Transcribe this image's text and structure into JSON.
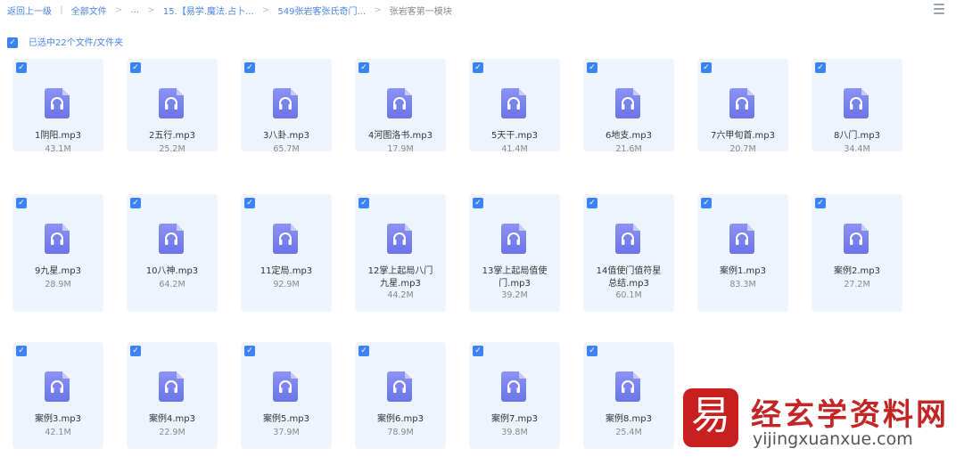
{
  "breadcrumb": {
    "back": "返回上一级",
    "root": "全部文件",
    "ellipsis": "...",
    "level1": "15.【易学.魔法.占卜...",
    "level2": "549张岩客张氏奇门...",
    "current": "张岩客第一模块"
  },
  "selection": {
    "text": "已选中22个文件/文件夹"
  },
  "icons": {
    "check": "checkmark-icon",
    "file": "audio-file-icon",
    "view": "list-view-icon"
  },
  "files": [
    {
      "name": "1阴阳.mp3",
      "size": "43.1M"
    },
    {
      "name": "2五行.mp3",
      "size": "25.2M"
    },
    {
      "name": "3八卦.mp3",
      "size": "65.7M"
    },
    {
      "name": "4河图洛书.mp3",
      "size": "17.9M"
    },
    {
      "name": "5天干.mp3",
      "size": "41.4M"
    },
    {
      "name": "6地支.mp3",
      "size": "21.6M"
    },
    {
      "name": "7六甲旬首.mp3",
      "size": "20.7M"
    },
    {
      "name": "8八门.mp3",
      "size": "34.4M"
    },
    {
      "name": "9九星.mp3",
      "size": "28.9M"
    },
    {
      "name": "10八神.mp3",
      "size": "64.2M"
    },
    {
      "name": "11定局.mp3",
      "size": "92.9M"
    },
    {
      "name": "12掌上起局八门九星.mp3",
      "size": "44.2M"
    },
    {
      "name": "13掌上起局值使门.mp3",
      "size": "39.2M"
    },
    {
      "name": "14值使门值符星总结.mp3",
      "size": "60.1M"
    },
    {
      "name": "案例1.mp3",
      "size": "83.3M"
    },
    {
      "name": "案例2.mp3",
      "size": "27.2M"
    },
    {
      "name": "案例3.mp3",
      "size": "42.1M"
    },
    {
      "name": "案例4.mp3",
      "size": "22.9M"
    },
    {
      "name": "案例5.mp3",
      "size": "37.9M"
    },
    {
      "name": "案例6.mp3",
      "size": "78.9M"
    },
    {
      "name": "案例7.mp3",
      "size": "39.8M"
    },
    {
      "name": "案例8.mp3",
      "size": "25.4M"
    }
  ],
  "watermark": {
    "logo_char": "易",
    "title": "经玄学资料网",
    "url": "yijingxuanxue.com"
  }
}
